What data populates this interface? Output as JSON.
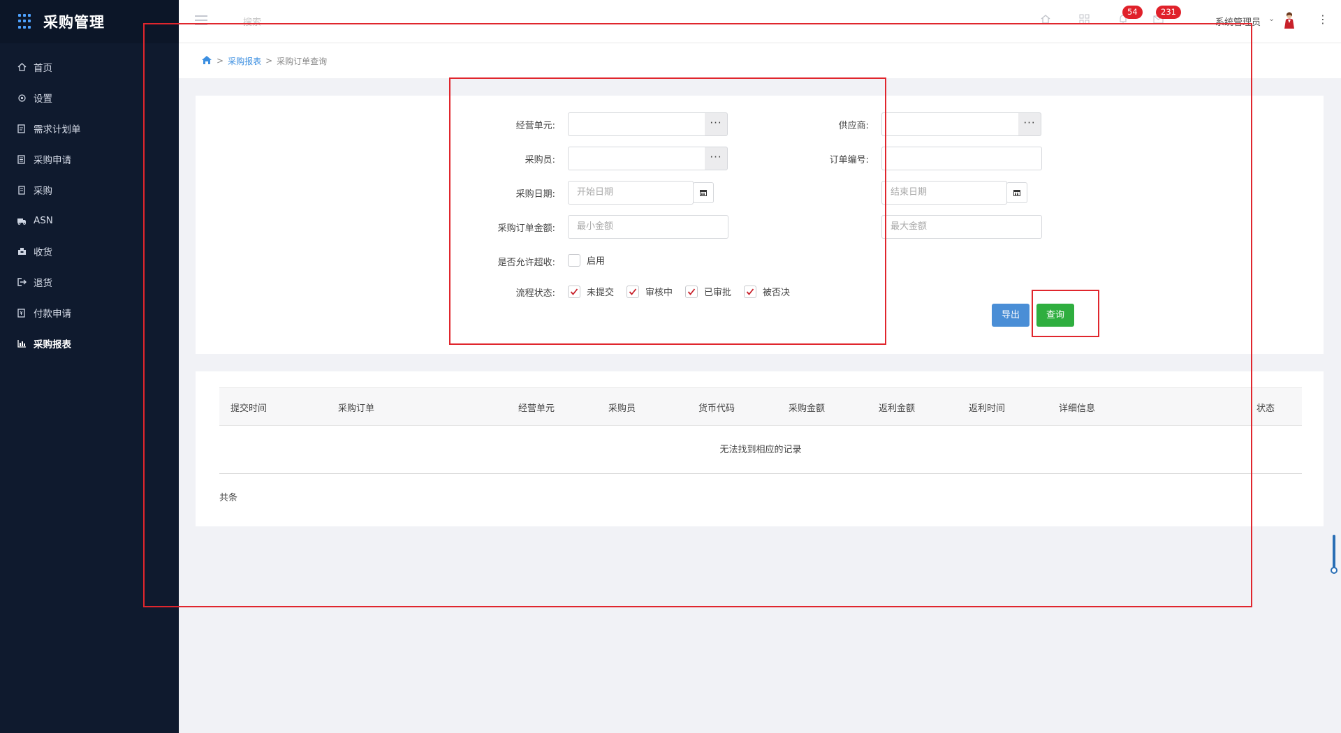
{
  "app": {
    "title": "采购管理"
  },
  "sidebar": {
    "items": [
      {
        "label": "首页",
        "icon": "home-icon"
      },
      {
        "label": "设置",
        "icon": "gear-icon"
      },
      {
        "label": "需求计划单",
        "icon": "document-icon"
      },
      {
        "label": "采购申请",
        "icon": "form-icon"
      },
      {
        "label": "采购",
        "icon": "list-icon"
      },
      {
        "label": "ASN",
        "icon": "truck-icon"
      },
      {
        "label": "收货",
        "icon": "inbox-icon"
      },
      {
        "label": "退货",
        "icon": "exit-icon"
      },
      {
        "label": "付款申请",
        "icon": "invoice-icon"
      },
      {
        "label": "采购报表",
        "icon": "bar-chart-icon",
        "active": true
      }
    ]
  },
  "topbar": {
    "search_hint": "搜索",
    "badge_1": "54",
    "badge_2": "231",
    "user_name": "系统管理员"
  },
  "breadcrumb": {
    "sep": ">",
    "parent": "采购报表",
    "current": "采购订单查询"
  },
  "filter": {
    "business_unit_label": "经营单元:",
    "supplier_label": "供应商:",
    "buyer_label": "采购员:",
    "order_no_label": "订单编号:",
    "date_label": "采购日期:",
    "start_date_placeholder": "开始日期",
    "end_date_placeholder": "结束日期",
    "amount_label": "采购订单金额:",
    "min_amount_placeholder": "最小金额",
    "max_amount_placeholder": "最大金额",
    "over_receive_label": "是否允许超收:",
    "over_receive_option": "启用",
    "status_label": "流程状态:",
    "status_options": [
      "未提交",
      "审核中",
      "已审批",
      "被否决"
    ],
    "export_button": "导出",
    "query_button": "查询"
  },
  "table": {
    "columns": [
      "提交时间",
      "采购订单",
      "经营单元",
      "采购员",
      "货币代码",
      "采购金额",
      "返利金额",
      "返利时间",
      "详细信息",
      "状态"
    ],
    "empty_text": "无法找到相应的记录",
    "total_text": "共条"
  },
  "colors": {
    "sidebar_bg": "#0f1a2e",
    "accent": "#3c8fe1",
    "query_button": "#2fae3f",
    "export_button": "#4a8ed6",
    "badge": "#e0212a",
    "annotation": "#e0262d"
  }
}
